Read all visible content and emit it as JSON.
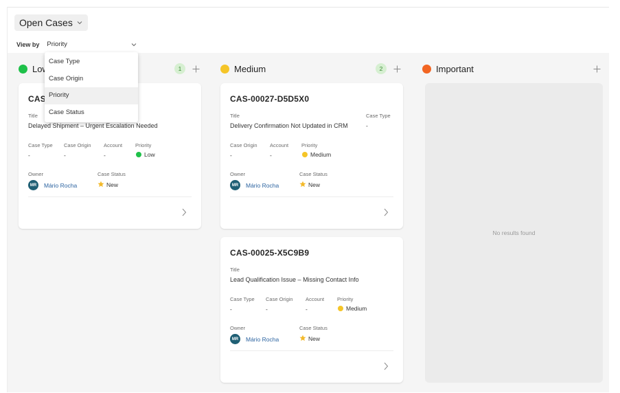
{
  "view": {
    "title": "Open Cases"
  },
  "view_by": {
    "label": "View by",
    "selected": "Priority",
    "options": [
      "Case Type",
      "Case Origin",
      "Priority",
      "Case Status"
    ]
  },
  "columns": [
    {
      "name": "Low",
      "color": "#1fc14a",
      "count": "1"
    },
    {
      "name": "Medium",
      "color": "#f5c528",
      "count": "2"
    },
    {
      "name": "Important",
      "color": "#f26522",
      "count": ""
    }
  ],
  "labels": {
    "title": "Title",
    "case_type": "Case Type",
    "case_origin": "Case Origin",
    "account": "Account",
    "priority": "Priority",
    "owner": "Owner",
    "case_status": "Case Status"
  },
  "cards": [
    {
      "id": "CAS-",
      "title": "Delayed Shipment – Urgent Escalation Needed",
      "case_type": "-",
      "case_origin": "-",
      "account": "-",
      "priority": "Low",
      "owner_initials": "MR",
      "owner": "Mário Rocha",
      "status": "New"
    },
    {
      "id": "CAS-00027-D5D5X0",
      "title": "Delivery Confirmation Not Updated in CRM",
      "case_type": "-",
      "case_origin": "-",
      "account": "-",
      "priority": "Medium",
      "owner_initials": "MR",
      "owner": "Mário Rocha",
      "status": "New"
    },
    {
      "id": "CAS-00025-X5C9B9",
      "title": "Lead Qualification Issue – Missing Contact Info",
      "case_type": "-",
      "case_origin": "-",
      "account": "-",
      "priority": "Medium",
      "owner_initials": "MR",
      "owner": "Mário Rocha",
      "status": "New"
    }
  ],
  "empty_text": "No results found",
  "colors": {
    "star": "#f3b92a",
    "accent_link": "#2b63a0"
  }
}
